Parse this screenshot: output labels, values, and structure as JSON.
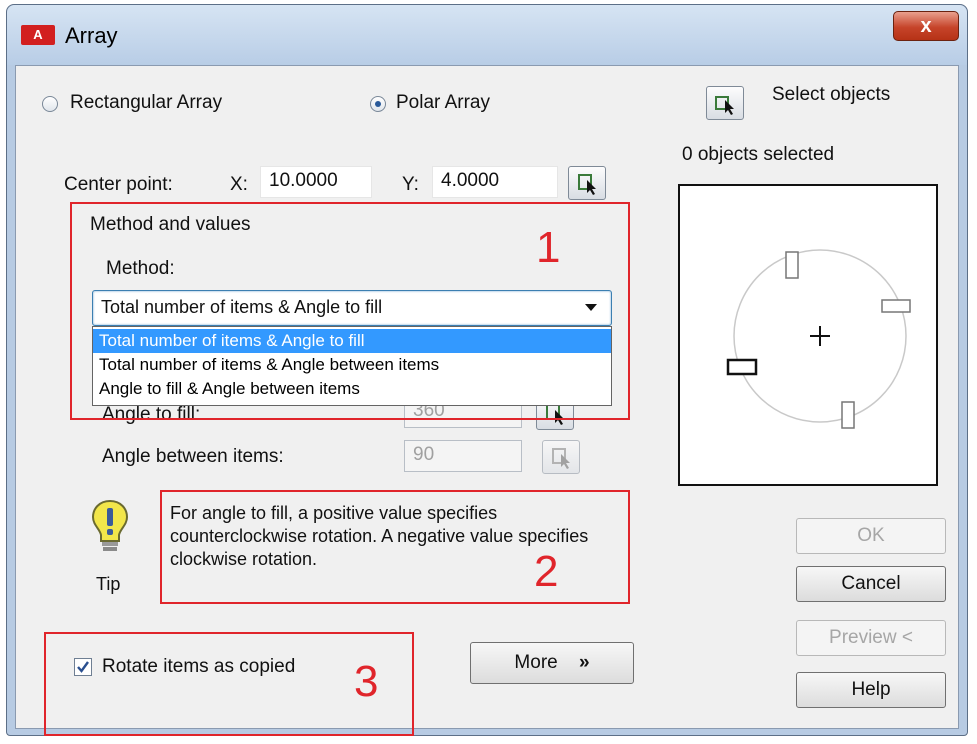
{
  "window": {
    "icon_text": "A",
    "title": "Array",
    "close_label": "x"
  },
  "array_type": {
    "rectangular_label": "Rectangular Array",
    "polar_label": "Polar Array",
    "selected": "Polar Array"
  },
  "select_objects": {
    "label": "Select objects",
    "status": "0 objects selected"
  },
  "center_point": {
    "label": "Center point:",
    "x_label": "X:",
    "x_value": "10.0000",
    "y_label": "Y:",
    "y_value": "4.0000"
  },
  "method": {
    "group_label": "Method and values",
    "label": "Method:",
    "selected": "Total number of items & Angle to fill",
    "options": [
      "Total number of items & Angle to fill",
      "Total number of items & Angle between items",
      "Angle to fill & Angle between items"
    ]
  },
  "angle_to_fill": {
    "label": "Angle to fill:",
    "value": "360"
  },
  "angle_between": {
    "label": "Angle between items:",
    "value": "90"
  },
  "tip": {
    "label": "Tip",
    "text": "For angle to fill, a positive value specifies counterclockwise rotation.  A negative value specifies clockwise rotation."
  },
  "rotate": {
    "label": "Rotate items as copied",
    "checked": true
  },
  "buttons": {
    "more": "More",
    "ok": "OK",
    "cancel": "Cancel",
    "preview": "Preview <",
    "help": "Help"
  },
  "annotations": [
    "1",
    "2",
    "3"
  ],
  "colors": {
    "annotation_red": "#e0252b",
    "selection_blue": "#3399ff"
  }
}
